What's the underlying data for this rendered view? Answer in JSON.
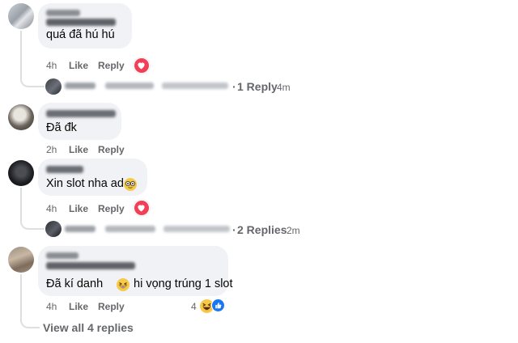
{
  "comments": [
    {
      "text": "quá đã hú hú",
      "actions": {
        "time": "4h",
        "like": "Like",
        "reply": "Reply"
      },
      "reaction": "heart-icon",
      "replies_summary": {
        "dot": "·",
        "label": "1 Reply",
        "time": "4m"
      }
    },
    {
      "text": "Đã đk",
      "actions": {
        "time": "2h",
        "like": "Like",
        "reply": "Reply"
      }
    },
    {
      "text": "Xin slot nha ad",
      "emoji": "nerd-glasses-emoji-icon",
      "actions": {
        "time": "4h",
        "like": "Like",
        "reply": "Reply"
      },
      "reaction": "heart-icon",
      "replies_summary": {
        "dot": "·",
        "label": "2 Replies",
        "time": "2m"
      }
    },
    {
      "text_before": "Đã kí danh",
      "text_after": "hi vọng trúng 1 slot",
      "emoji": "grinning-squint-emoji-icon",
      "actions": {
        "time": "4h",
        "like": "Like",
        "reply": "Reply"
      },
      "reaction_count": "4",
      "reactions": [
        "laugh-icon",
        "like-icon"
      ]
    }
  ],
  "view_all": "View all 4 replies",
  "colors": {
    "bubble": "#f0f2f5",
    "secondary_text": "#65676b",
    "heart": "#f33e58",
    "like": "#1877f2",
    "thread_line": "#dddfe2"
  }
}
